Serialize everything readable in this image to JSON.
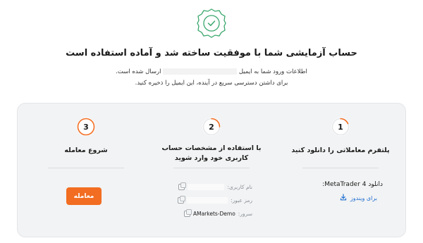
{
  "header": {
    "title": "حساب آزمایشی شما با موفقیت ساخته شد و آماده استفاده است",
    "email_line_start": "اطلاعات ورود شما به ایمیل",
    "email_line_end": "ارسال شده است.",
    "save_line": "برای داشتن دسترسی سریع در آینده، این ایمیل را ذخیره کنید."
  },
  "steps": [
    {
      "number": "1",
      "title": "پلتفرم معاملاتی را دانلود کنید",
      "download_label": "دانلود MetaTrader 4:",
      "windows_link": "برای ویندوز"
    },
    {
      "number": "2",
      "title_line1": "با استفاده از مشخصات حساب",
      "title_line2": "کاربری خود وارد شوید",
      "username_label": "نام کاربری:",
      "password_label": "رمز عبور:",
      "server_label": "سرور:",
      "server_value": "AMarkets-Demo"
    },
    {
      "number": "3",
      "title": "شروع معامله",
      "trade_button": "معامله"
    }
  ],
  "colors": {
    "accent_green": "#3aa76d",
    "accent_orange": "#f26d21",
    "link_blue": "#1f6fd1"
  },
  "icons": [
    "check-badge-icon",
    "download-icon",
    "copy-icon"
  ]
}
